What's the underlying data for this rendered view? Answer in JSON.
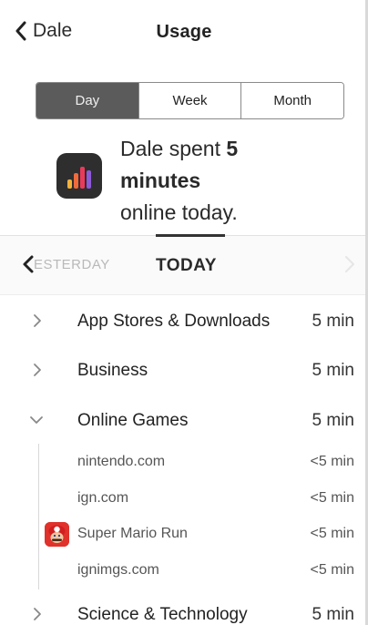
{
  "nav": {
    "back_label": "Dale",
    "title": "Usage"
  },
  "segments": [
    {
      "label": "Day",
      "active": true
    },
    {
      "label": "Week",
      "active": false
    },
    {
      "label": "Month",
      "active": false
    }
  ],
  "summary": {
    "line1_prefix": "Dale spent ",
    "line1_value": "5",
    "line2": "minutes",
    "line3": "online today."
  },
  "pager": {
    "previous_label": "ESTERDAY",
    "current_label": "TODAY"
  },
  "categories": [
    {
      "name": "App Stores & Downloads",
      "duration": "5 min",
      "expanded": false
    },
    {
      "name": "Business",
      "duration": "5 min",
      "expanded": false
    },
    {
      "name": "Online Games",
      "duration": "5 min",
      "expanded": true
    },
    {
      "name": "Science & Technology",
      "duration": "5 min",
      "expanded": false
    }
  ],
  "sites": [
    {
      "name": "nintendo.com",
      "duration": "<5 min"
    },
    {
      "name": "ign.com",
      "duration": "<5 min"
    },
    {
      "name": "Super Mario Run",
      "duration": "<5 min",
      "icon": "super-mario-run-app-icon"
    },
    {
      "name": "ignimgs.com",
      "duration": "<5 min"
    }
  ],
  "colors": {
    "segment_active_bg": "#5b5b5b",
    "app_icon_bg": "#2e2e2e",
    "mario_red": "#e0312a"
  }
}
